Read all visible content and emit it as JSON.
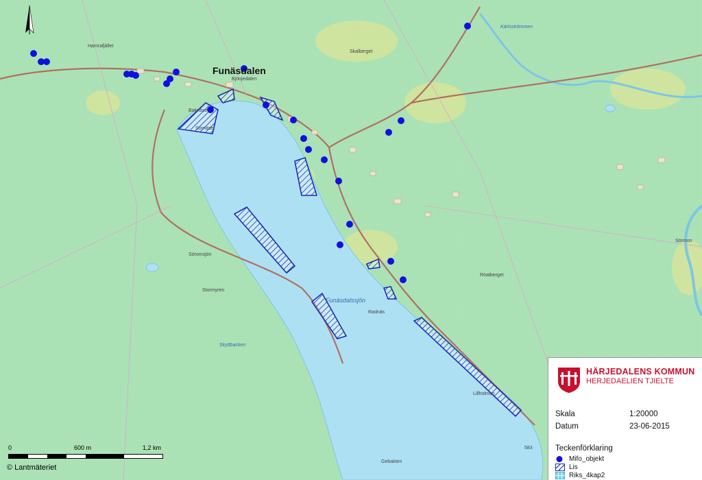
{
  "map": {
    "place_labels": {
      "funasdalen": "Funäsdalen",
      "hamrafjallet": "Hamrafjället",
      "bjorsjo": "Bjönjedalen",
      "karlsstrommen": "Kärlsströmmen",
      "skalberget": "Skalberget",
      "roatberget": "Röatberget",
      "soromsjon": "Söromsjön",
      "funasdalssjon": "Funäsdalssjön",
      "baknaset": "Baknäset",
      "sorrnas": "Sörnäset",
      "lillholmen": "Lillholmen",
      "gebakten": "Gebakten",
      "sormon": "Sörmon",
      "radnas": "Radnäs",
      "skyttbacken": "Skyttbacken",
      "stormyren": "Stormyren",
      "elevation": "583"
    },
    "north_arrow": "north-arrow-icon"
  },
  "scalebar": {
    "label_start": "0",
    "label_mid": "600 m",
    "label_end": "1,2 km"
  },
  "copyright": "© Lantmäteriet",
  "info_panel": {
    "org_name": "HÄRJEDALENS KOMMUN",
    "org_name_alt": "HERJEDAELIEN TJIELTE",
    "scale_label": "Skala",
    "scale_value": "1:20000",
    "date_label": "Datum",
    "date_value": "23-06-2015",
    "legend_title": "Teckenförklaring",
    "legend": [
      {
        "label": "Mifo_objekt",
        "symbol": "blue-dot-icon"
      },
      {
        "label": "Lis",
        "symbol": "hatched-polygon-icon"
      },
      {
        "label": "Riks_4kap2",
        "symbol": "cyan-grid-icon"
      }
    ]
  },
  "colors": {
    "land": "#a9e1b4",
    "water": "#aee0f4",
    "road": "#b07060",
    "accent_red": "#c8102e",
    "marker_blue": "#1010e0"
  }
}
